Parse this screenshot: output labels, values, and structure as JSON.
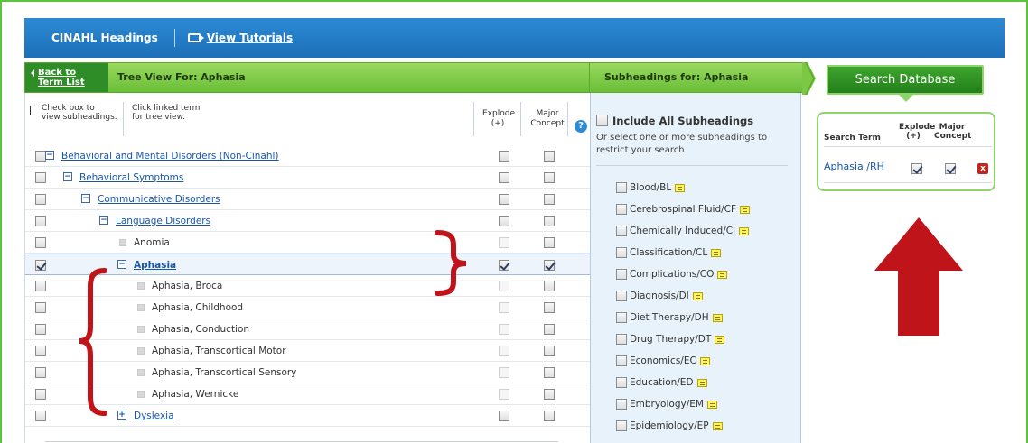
{
  "header": {
    "brand": "CINAHL Headings",
    "tutorials": "View Tutorials"
  },
  "crumb": {
    "back_line1": "Back to",
    "back_line2": "Term List",
    "tree_title": "Tree View For: Aphasia",
    "subs_title": "Subheadings for: Aphasia"
  },
  "hints": {
    "h1_line1": "Check box to",
    "h1_line2": "view subheadings.",
    "h2_line1": "Click linked term",
    "h2_line2": "for tree view."
  },
  "columns": {
    "explode_line1": "Explode",
    "explode_line2": "(+)",
    "major_line1": "Major",
    "major_line2": "Concept",
    "help": "?"
  },
  "tree": [
    {
      "label": "Behavioral and Mental Disorders (Non-Cinahl)",
      "indent": 0,
      "type": "link",
      "toggle": "⊟"
    },
    {
      "label": "Behavioral Symptoms",
      "indent": 1,
      "type": "link",
      "toggle": "⊟"
    },
    {
      "label": "Communicative Disorders",
      "indent": 2,
      "type": "link",
      "toggle": "⊟"
    },
    {
      "label": "Language Disorders",
      "indent": 3,
      "type": "link",
      "toggle": "⊟"
    },
    {
      "label": "Anomia",
      "indent": 4,
      "type": "leaf"
    },
    {
      "label": "Aphasia",
      "indent": 4,
      "type": "selected",
      "toggle": "⊟"
    },
    {
      "label": "Aphasia, Broca",
      "indent": 5,
      "type": "leaf"
    },
    {
      "label": "Aphasia, Childhood",
      "indent": 5,
      "type": "leaf"
    },
    {
      "label": "Aphasia, Conduction",
      "indent": 5,
      "type": "leaf"
    },
    {
      "label": "Aphasia, Transcortical Motor",
      "indent": 5,
      "type": "leaf"
    },
    {
      "label": "Aphasia, Transcortical Sensory",
      "indent": 5,
      "type": "leaf"
    },
    {
      "label": "Aphasia, Wernicke",
      "indent": 5,
      "type": "leaf"
    },
    {
      "label": "Dyslexia",
      "indent": 4,
      "type": "link",
      "toggle": "⊞"
    }
  ],
  "subheadings": {
    "include_all": "Include All Subheadings",
    "description": "Or select one or more subheadings to restrict your search",
    "items": [
      "Blood/BL",
      "Cerebrospinal Fluid/CF",
      "Chemically Induced/CI",
      "Classification/CL",
      "Complications/CO",
      "Diagnosis/DI",
      "Diet Therapy/DH",
      "Drug Therapy/DT",
      "Economics/EC",
      "Education/ED",
      "Embryology/EM",
      "Epidemiology/EP"
    ]
  },
  "search_box": {
    "button": "Search Database",
    "col_term": "Search Term",
    "col_explode_line1": "Explode",
    "col_explode_line2": "(+)",
    "col_major_line1": "Major",
    "col_major_line2": "Concept",
    "term": "Aphasia /RH",
    "delete": "x"
  },
  "colors": {
    "accent_blue": "#1c6fb8",
    "green": "#6abe38",
    "annotation_red": "#c0141b"
  }
}
